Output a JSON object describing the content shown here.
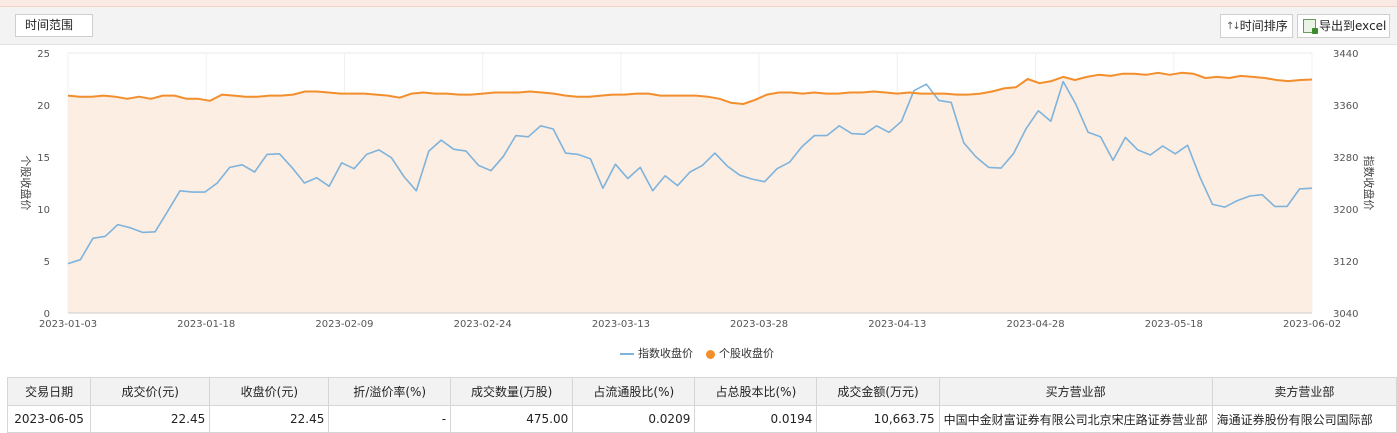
{
  "toolbar": {
    "range_label": "时间范围",
    "sort_label": "时间排序",
    "export_label": "导出到excel"
  },
  "legend": {
    "index_label": "指数收盘价",
    "stock_label": "个股收盘价"
  },
  "colors": {
    "index_line": "#7eb3dc",
    "stock_line": "#f28e2b",
    "stock_area": "#fdeee3"
  },
  "chart_data": {
    "type": "line",
    "x_ticks": [
      "2023-01-03",
      "2023-01-18",
      "2023-02-09",
      "2023-02-24",
      "2023-03-13",
      "2023-03-28",
      "2023-04-13",
      "2023-04-28",
      "2023-05-18",
      "2023-06-02"
    ],
    "y_left": {
      "label": "个股收盘价",
      "ticks": [
        "0",
        "5",
        "10",
        "15",
        "20",
        "25"
      ],
      "range": [
        0,
        25
      ]
    },
    "y_right": {
      "label": "指数收盘价",
      "ticks": [
        "3040",
        "3120",
        "3200",
        "3280",
        "3360",
        "3440"
      ],
      "range": [
        3040,
        3440
      ]
    },
    "grid": true,
    "legend_position": "bottom-center",
    "series": [
      {
        "name": "指数收盘价",
        "axis": "right",
        "values": [
          3116,
          3122,
          3155,
          3158,
          3176,
          3171,
          3164,
          3165,
          3196,
          3228,
          3226,
          3226,
          3240,
          3264,
          3268,
          3257,
          3284,
          3285,
          3264,
          3240,
          3248,
          3235,
          3271,
          3262,
          3284,
          3291,
          3279,
          3250,
          3228,
          3289,
          3306,
          3292,
          3289,
          3267,
          3259,
          3281,
          3313,
          3311,
          3328,
          3323,
          3286,
          3284,
          3277,
          3232,
          3269,
          3247,
          3264,
          3228,
          3251,
          3236,
          3257,
          3267,
          3286,
          3266,
          3252,
          3246,
          3242,
          3262,
          3272,
          3296,
          3313,
          3313,
          3328,
          3316,
          3315,
          3328,
          3318,
          3335,
          3382,
          3392,
          3367,
          3364,
          3302,
          3280,
          3264,
          3263,
          3285,
          3323,
          3351,
          3335,
          3396,
          3362,
          3318,
          3311,
          3275,
          3310,
          3291,
          3283,
          3297,
          3285,
          3298,
          3249,
          3207,
          3203,
          3213,
          3220,
          3222,
          3204,
          3204,
          3231,
          3232
        ]
      },
      {
        "name": "个股收盘价",
        "axis": "left",
        "values": [
          20.9,
          20.8,
          20.8,
          20.9,
          20.8,
          20.6,
          20.8,
          20.6,
          20.9,
          20.9,
          20.6,
          20.6,
          20.4,
          21.0,
          20.9,
          20.8,
          20.8,
          20.9,
          20.9,
          21.0,
          21.3,
          21.3,
          21.2,
          21.1,
          21.1,
          21.1,
          21.0,
          20.9,
          20.7,
          21.1,
          21.2,
          21.1,
          21.1,
          21.0,
          21.0,
          21.1,
          21.2,
          21.2,
          21.2,
          21.3,
          21.2,
          21.1,
          20.9,
          20.8,
          20.8,
          20.9,
          21.0,
          21.0,
          21.1,
          21.1,
          20.9,
          20.9,
          20.9,
          20.9,
          20.8,
          20.6,
          20.2,
          20.1,
          20.5,
          21.0,
          21.2,
          21.2,
          21.1,
          21.2,
          21.1,
          21.1,
          21.2,
          21.2,
          21.3,
          21.2,
          21.1,
          21.2,
          21.1,
          21.1,
          21.1,
          21.0,
          21.0,
          21.1,
          21.3,
          21.6,
          21.7,
          22.5,
          22.1,
          22.3,
          22.7,
          22.4,
          22.7,
          22.9,
          22.8,
          23.0,
          23.0,
          22.9,
          23.1,
          22.9,
          23.1,
          23.0,
          22.6,
          22.7,
          22.6,
          22.8,
          22.7,
          22.6,
          22.4,
          22.3,
          22.4,
          22.45
        ]
      }
    ]
  },
  "table": {
    "headers": [
      "交易日期",
      "成交价(元)",
      "收盘价(元)",
      "折/溢价率(%)",
      "成交数量(万股)",
      "占流通股比(%)",
      "占总股本比(%)",
      "成交金额(万元)",
      "买方营业部",
      "卖方营业部"
    ],
    "rows": [
      [
        "2023-06-05",
        "22.45",
        "22.45",
        "-",
        "475.00",
        "0.0209",
        "0.0194",
        "10,663.75",
        "中国中金财富证券有限公司北京宋庄路证券营业部",
        "海通证券股份有限公司国际部"
      ]
    ]
  }
}
